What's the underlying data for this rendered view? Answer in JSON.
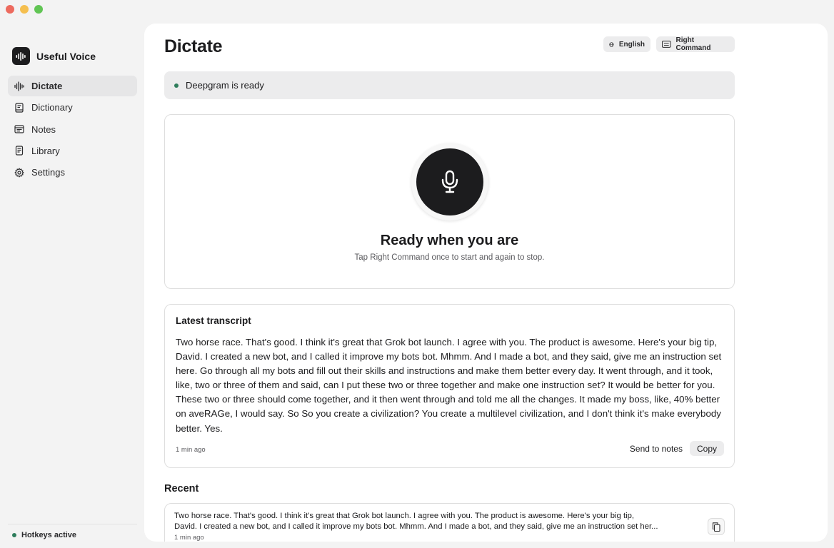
{
  "app": {
    "name": "Useful Voice"
  },
  "sidebar": {
    "items": [
      {
        "label": "Dictate",
        "icon": "waveform-icon",
        "active": true
      },
      {
        "label": "Dictionary",
        "icon": "book-icon",
        "active": false
      },
      {
        "label": "Notes",
        "icon": "notes-icon",
        "active": false
      },
      {
        "label": "Library",
        "icon": "document-icon",
        "active": false
      },
      {
        "label": "Settings",
        "icon": "gear-icon",
        "active": false
      }
    ],
    "footer_status": "Hotkeys active"
  },
  "header": {
    "title": "Dictate",
    "language_label": "English",
    "hotkey_label": "Right Command"
  },
  "status": {
    "text": "Deepgram is ready",
    "color": "#2e7d5b"
  },
  "recorder": {
    "title": "Ready when you are",
    "subtitle": "Tap Right Command once to start and again to stop."
  },
  "latest_transcript": {
    "title": "Latest transcript",
    "text": "Two horse race. That's good. I think it's great that Grok bot launch. I agree with you. The product is awesome. Here's your big tip, David. I created a new bot, and I called it improve my bots bot. Mhmm. And I made a bot, and they said, give me an instruction set here. Go through all my bots and fill out their skills and instructions and make them better every day. It went through, and it took, like, two or three of them and said, can I put these two or three together and make one instruction set? It would be better for you. These two or three should come together, and it then went through and told me all the changes. It made my boss, like, 40% better on aveRAGe, I would say. So So you create a civilization? You create a multilevel civilization, and I don't think it's make everybody better. Yes.",
    "time": "1 min ago",
    "send_label": "Send to notes",
    "copy_label": "Copy"
  },
  "recent": {
    "title": "Recent",
    "items": [
      {
        "text_line1": "Two horse race. That's good. I think it's great that Grok bot launch. I agree with you. The product is awesome. Here's your big tip,",
        "text_line2": "David. I created a new bot, and I called it improve my bots bot. Mhmm. And I made a bot, and they said, give me an instruction set her...",
        "time": "1 min ago"
      }
    ]
  },
  "colors": {
    "accent_dark": "#1c1c1e",
    "status_green": "#2e7d5b",
    "background": "#f3f3f3"
  }
}
